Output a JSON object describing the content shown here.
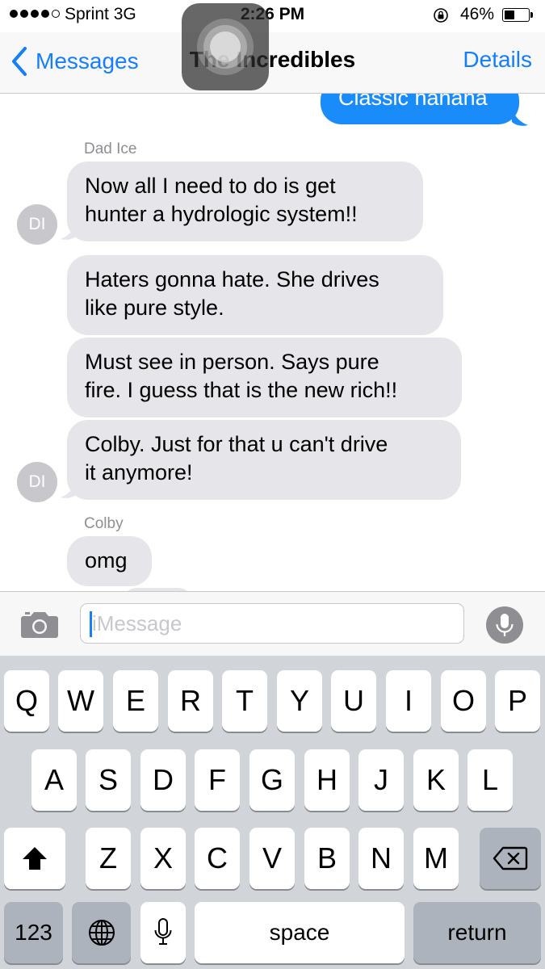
{
  "status_bar": {
    "carrier": "Sprint  3G",
    "time": "2:26 PM",
    "battery_percent_text": "46%",
    "battery_level": 0.46
  },
  "nav": {
    "back_label": "Messages",
    "title": "The Incredibles",
    "details_label": "Details"
  },
  "messages": {
    "outgoing_text": "Classic hahaha",
    "sender1": "Dad Ice",
    "sender1_initials": "DI",
    "m1_line1": "Now all I need to do is get",
    "m1_line2": "hunter a hydrologic  system!!",
    "m2_line1": "Haters gonna hate. She drives",
    "m2_line2": "like pure style.",
    "m3_line1": "Must see in person. Says pure",
    "m3_line2": "fire. I guess that is the new rich!!",
    "m4_line1": "Colby. Just for that u can't drive",
    "m4_line2": "it anymore!",
    "sender2": "Colby",
    "m5_line1": "omg"
  },
  "input": {
    "placeholder": "iMessage",
    "value": ""
  },
  "keyboard": {
    "row1": [
      "Q",
      "W",
      "E",
      "R",
      "T",
      "Y",
      "U",
      "I",
      "O",
      "P"
    ],
    "row2": [
      "A",
      "S",
      "D",
      "F",
      "G",
      "H",
      "J",
      "K",
      "L"
    ],
    "row3": [
      "Z",
      "X",
      "C",
      "V",
      "B",
      "N",
      "M"
    ],
    "numbers_label": "123",
    "space_label": "space",
    "return_label": "return"
  },
  "colors": {
    "ios_blue": "#147efb",
    "outgoing_bubble": "#1a8cf9",
    "incoming_bubble": "#e5e5ea",
    "keyboard_bg": "#d1d4d9"
  },
  "icons": [
    "lock-rotation-icon",
    "battery-icon",
    "chevron-left-icon",
    "assistive-touch-icon",
    "camera-icon",
    "microphone-icon",
    "shift-icon",
    "delete-icon",
    "globe-icon"
  ]
}
